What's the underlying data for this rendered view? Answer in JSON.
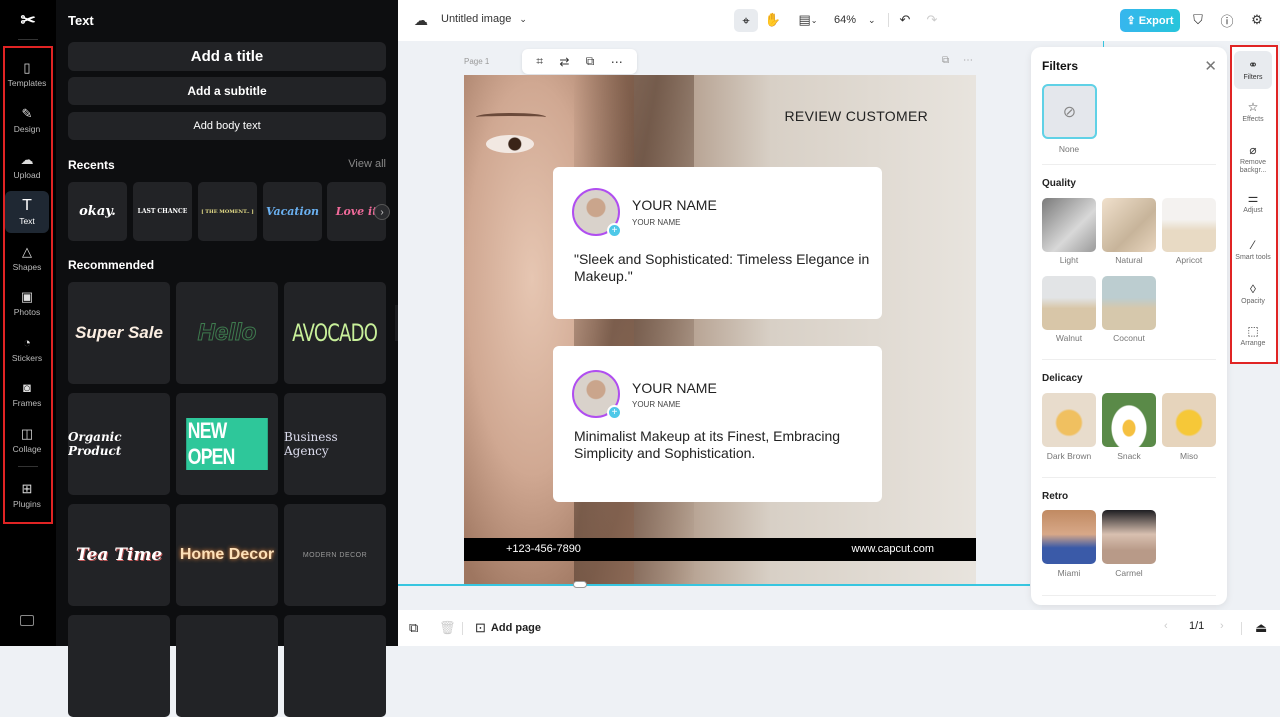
{
  "app": {
    "logo": "CapCut"
  },
  "rail": {
    "items": [
      {
        "label": "Templates",
        "icon": "templates-icon"
      },
      {
        "label": "Design",
        "icon": "design-icon"
      },
      {
        "label": "Upload",
        "icon": "upload-icon"
      },
      {
        "label": "Text",
        "icon": "text-icon",
        "active": true
      },
      {
        "label": "Shapes",
        "icon": "shapes-icon"
      },
      {
        "label": "Photos",
        "icon": "photos-icon"
      },
      {
        "label": "Stickers",
        "icon": "stickers-icon"
      },
      {
        "label": "Frames",
        "icon": "frames-icon"
      },
      {
        "label": "Collage",
        "icon": "collage-icon"
      },
      {
        "label": "Plugins",
        "icon": "plugins-icon"
      }
    ]
  },
  "text_panel": {
    "title": "Text",
    "add_title": "Add a title",
    "add_subtitle": "Add a subtitle",
    "add_body": "Add body text",
    "recents_label": "Recents",
    "view_all": "View all",
    "recents": [
      "okay.",
      "LAST CHANCE",
      "[ THE MOMENT.. ]",
      "Vacation",
      "Love it"
    ],
    "recommended_label": "Recommended",
    "recommended": [
      "Super Sale",
      "Hello",
      "AVOCADO",
      "Organic Product",
      "NEW OPEN",
      "Business Agency",
      "Tea Time",
      "Home Decor",
      "MODERN DECOR"
    ]
  },
  "topbar": {
    "doc_title": "Untitled image",
    "zoom": "64%",
    "export": "Export"
  },
  "canvas": {
    "page_label": "Page 1",
    "design": {
      "heading": "REVIEW CUSTOMER",
      "cards": [
        {
          "name": "YOUR NAME",
          "subname": "YOUR NAME",
          "quote": "\"Sleek and Sophisticated: Timeless Elegance in Makeup.\""
        },
        {
          "name": "YOUR NAME",
          "subname": "YOUR NAME",
          "quote": "Minimalist Makeup at its Finest, Embracing Simplicity and Sophistication."
        }
      ],
      "phone": "+123-456-7890",
      "website": "www.capcut.com"
    }
  },
  "filters": {
    "title": "Filters",
    "none_label": "None",
    "sections": [
      {
        "name": "Quality",
        "items": [
          "Light",
          "Natural",
          "Apricot",
          "Walnut",
          "Coconut"
        ]
      },
      {
        "name": "Delicacy",
        "items": [
          "Dark Brown",
          "Snack",
          "Miso"
        ]
      },
      {
        "name": "Retro",
        "items": [
          "Miami",
          "Carmel"
        ]
      }
    ]
  },
  "right_toolbar": {
    "items": [
      {
        "label": "Filters",
        "active": true
      },
      {
        "label": "Effects"
      },
      {
        "label": "Remove backgr..."
      },
      {
        "label": "Adjust"
      },
      {
        "label": "Smart tools"
      },
      {
        "label": "Opacity"
      },
      {
        "label": "Arrange"
      }
    ]
  },
  "bottombar": {
    "add_page": "Add page",
    "page_counter": "1/1"
  }
}
